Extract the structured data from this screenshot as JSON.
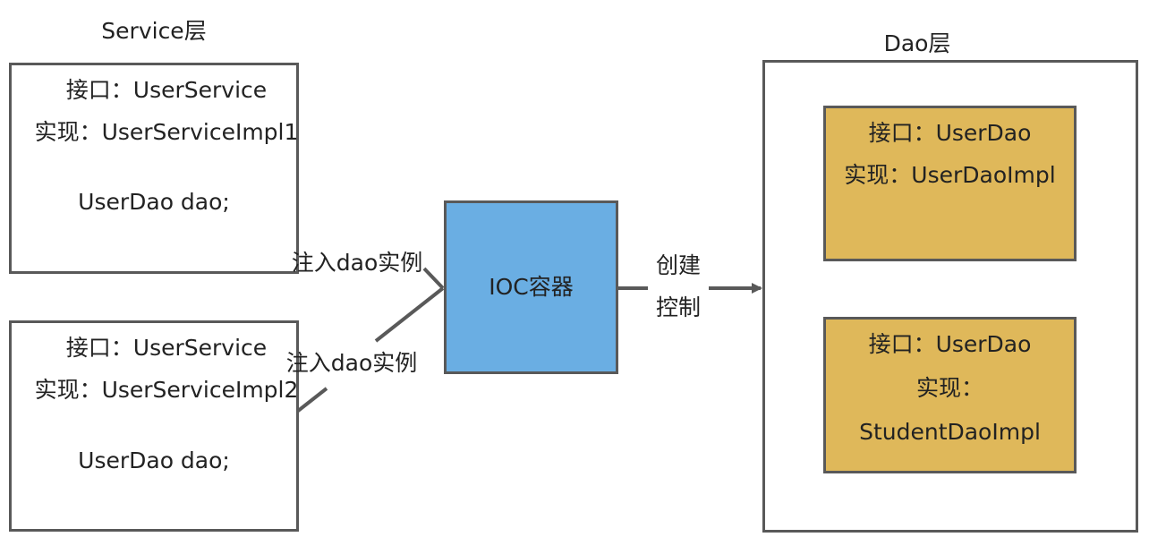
{
  "service_layer": {
    "title": "Service层",
    "box1": {
      "interface": "接口：UserService",
      "implementation": "实现：UserServiceImpl1",
      "field": "UserDao dao;"
    },
    "box2": {
      "interface": "接口：UserService",
      "implementation": "实现：UserServiceImpl2",
      "field": "UserDao dao;"
    }
  },
  "ioc": {
    "label": "IOC容器",
    "fill": "#6aaee3"
  },
  "dao_layer": {
    "title": "Dao层",
    "impl_fill": "#dfb85a",
    "box1": {
      "interface": "接口：UserDao",
      "implementation": "实现：UserDaoImpl"
    },
    "box2": {
      "interface": "接口：UserDao",
      "implementation_prefix": "实现：",
      "implementation_class": "StudentDaoImpl"
    }
  },
  "edges": {
    "inject_label_1": "注入dao实例",
    "inject_label_2": "注入dao实例",
    "create_control_line1": "创建",
    "create_control_line2": "控制"
  },
  "colors": {
    "border": "#595959",
    "arrow": "#595959"
  }
}
